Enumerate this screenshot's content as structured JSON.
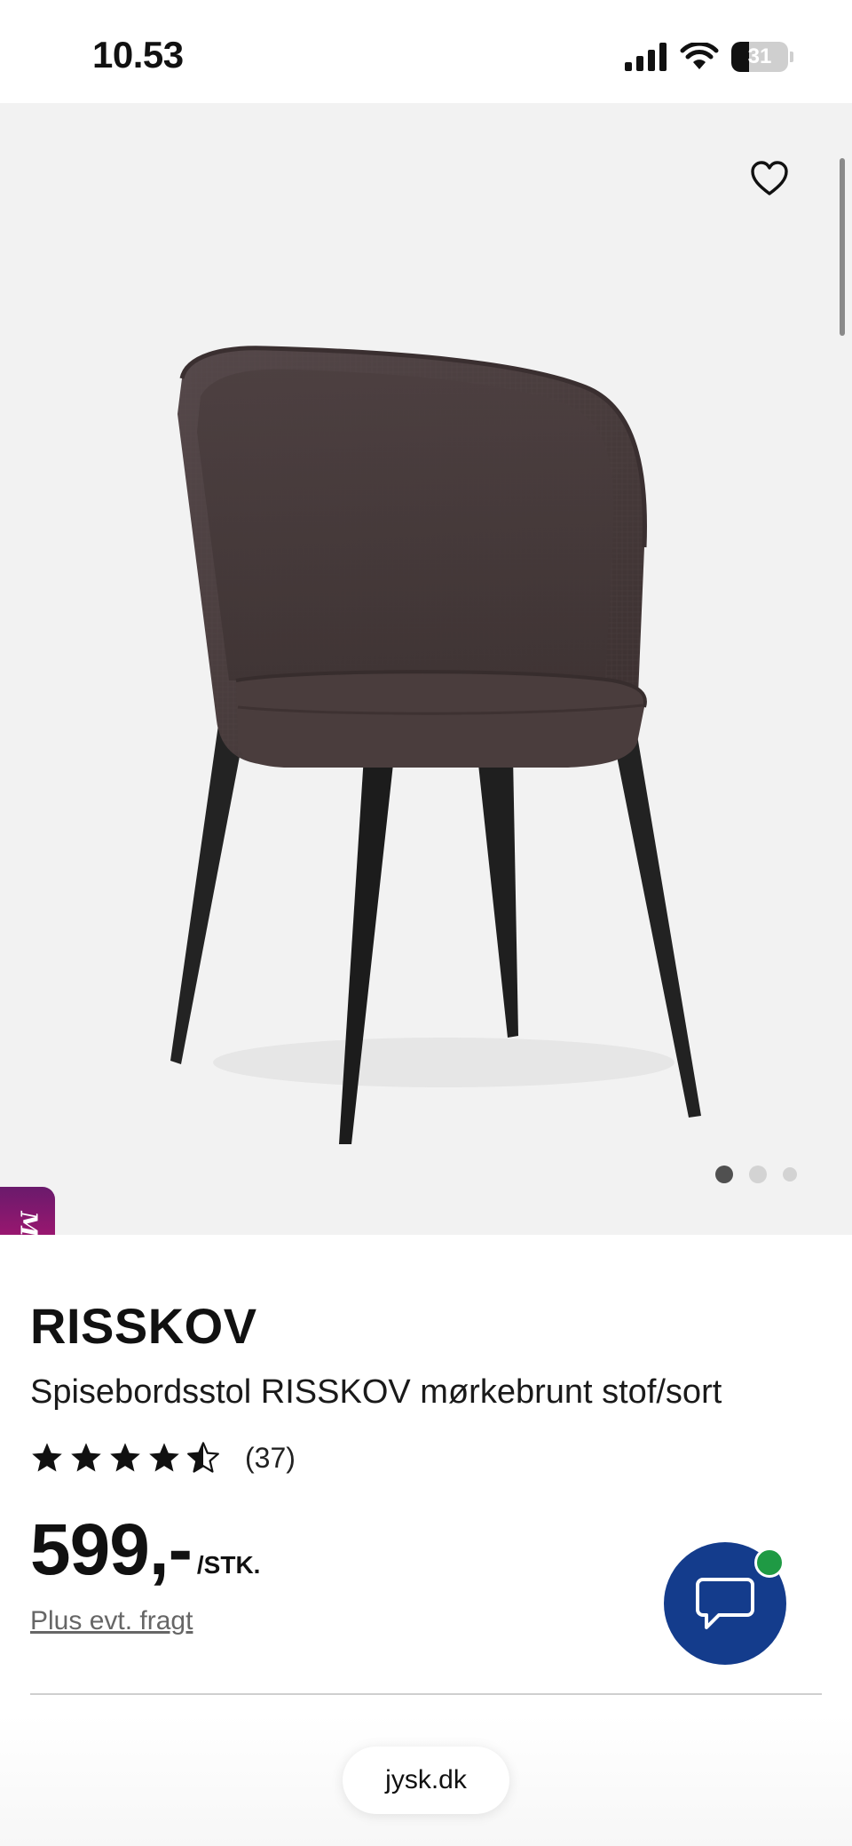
{
  "status_bar": {
    "time": "10.53",
    "battery_level": "31",
    "icons": [
      "cellular-signal-icon",
      "wifi-icon",
      "battery-icon"
    ]
  },
  "gallery": {
    "image_alt": "Spisebordsstol RISSKOV mørkebrunt stof/sort",
    "favorite_icon": "heart-outline-icon",
    "slide_count": 3,
    "active_slide": 1,
    "molly_label": "Molly"
  },
  "product": {
    "brand": "RISSKOV",
    "name": "Spisebordsstol RISSKOV mørkebrunt stof/sort",
    "rating": 4.5,
    "rating_max": 5,
    "review_count": "(37)",
    "price": "599,-",
    "price_unit": "/STK.",
    "shipping_note": "Plus evt. fragt"
  },
  "chat": {
    "icon": "chat-bubble-icon",
    "status_color": "#1f9a44",
    "button_color": "#143c8c"
  },
  "browser": {
    "url": "jysk.dk"
  },
  "colors": {
    "molly_gradient_start": "#6a1a6c",
    "molly_gradient_end": "#d0156b",
    "chair_fabric": "#4a3d3c",
    "chair_legs": "#1e1e1e"
  }
}
